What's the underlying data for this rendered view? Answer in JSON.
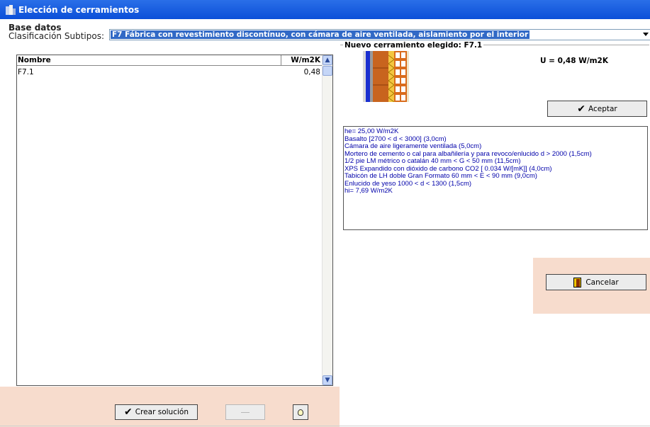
{
  "window": {
    "title": "Elección de cerramientos"
  },
  "base_datos": {
    "label": "Base datos",
    "clasificacion_label": "Clasificación Subtipos:",
    "selected_subtype": "F7 Fábrica con revestimiento discontínuo, con cámara de aire ventilada, aislamiento por el interior"
  },
  "table": {
    "columns": [
      "Nombre",
      "W/m2K"
    ],
    "rows": [
      {
        "nombre": "F7.1",
        "u": "0,48"
      }
    ]
  },
  "nuevo": {
    "title": "Nuevo cerramiento elegido: F7.1",
    "u_value": "U = 0,48 W/m2K",
    "aceptar_label": "Aceptar"
  },
  "description_lines": [
    "he= 25,00 W/m2K",
    "Basalto [2700 < d < 3000] (3,0cm)",
    "Cámara de aire ligeramente ventilada (5,0cm)",
    "Mortero de cemento o cal para albañilería y para revoco/enlucido d > 2000 (1,5cm)",
    "1/2 pie LM métrico o catalán 40 mm < G < 50 mm (11,5cm)",
    "XPS Expandido con dióxido de carbono CO2 [ 0.034 W/[mK]] (4,0cm)",
    "Tabicón de LH doble Gran Formato 60 mm < E < 90 mm (9,0cm)",
    "Enlucido de yeso 1000 < d < 1300 (1,5cm)",
    "hi= 7,69 W/m2K"
  ],
  "buttons": {
    "cancelar_label": "Cancelar",
    "crear_label": "Crear solución"
  },
  "icons": {
    "app": "building-icon",
    "check": "checkmark-icon",
    "door": "exit-door-icon",
    "bulb": "lightbulb-icon"
  },
  "colors": {
    "titlebar": "#0b4fd8",
    "selection": "#3169c6",
    "panel_highlight": "#f7dccd",
    "description_text": "#0000aa"
  }
}
